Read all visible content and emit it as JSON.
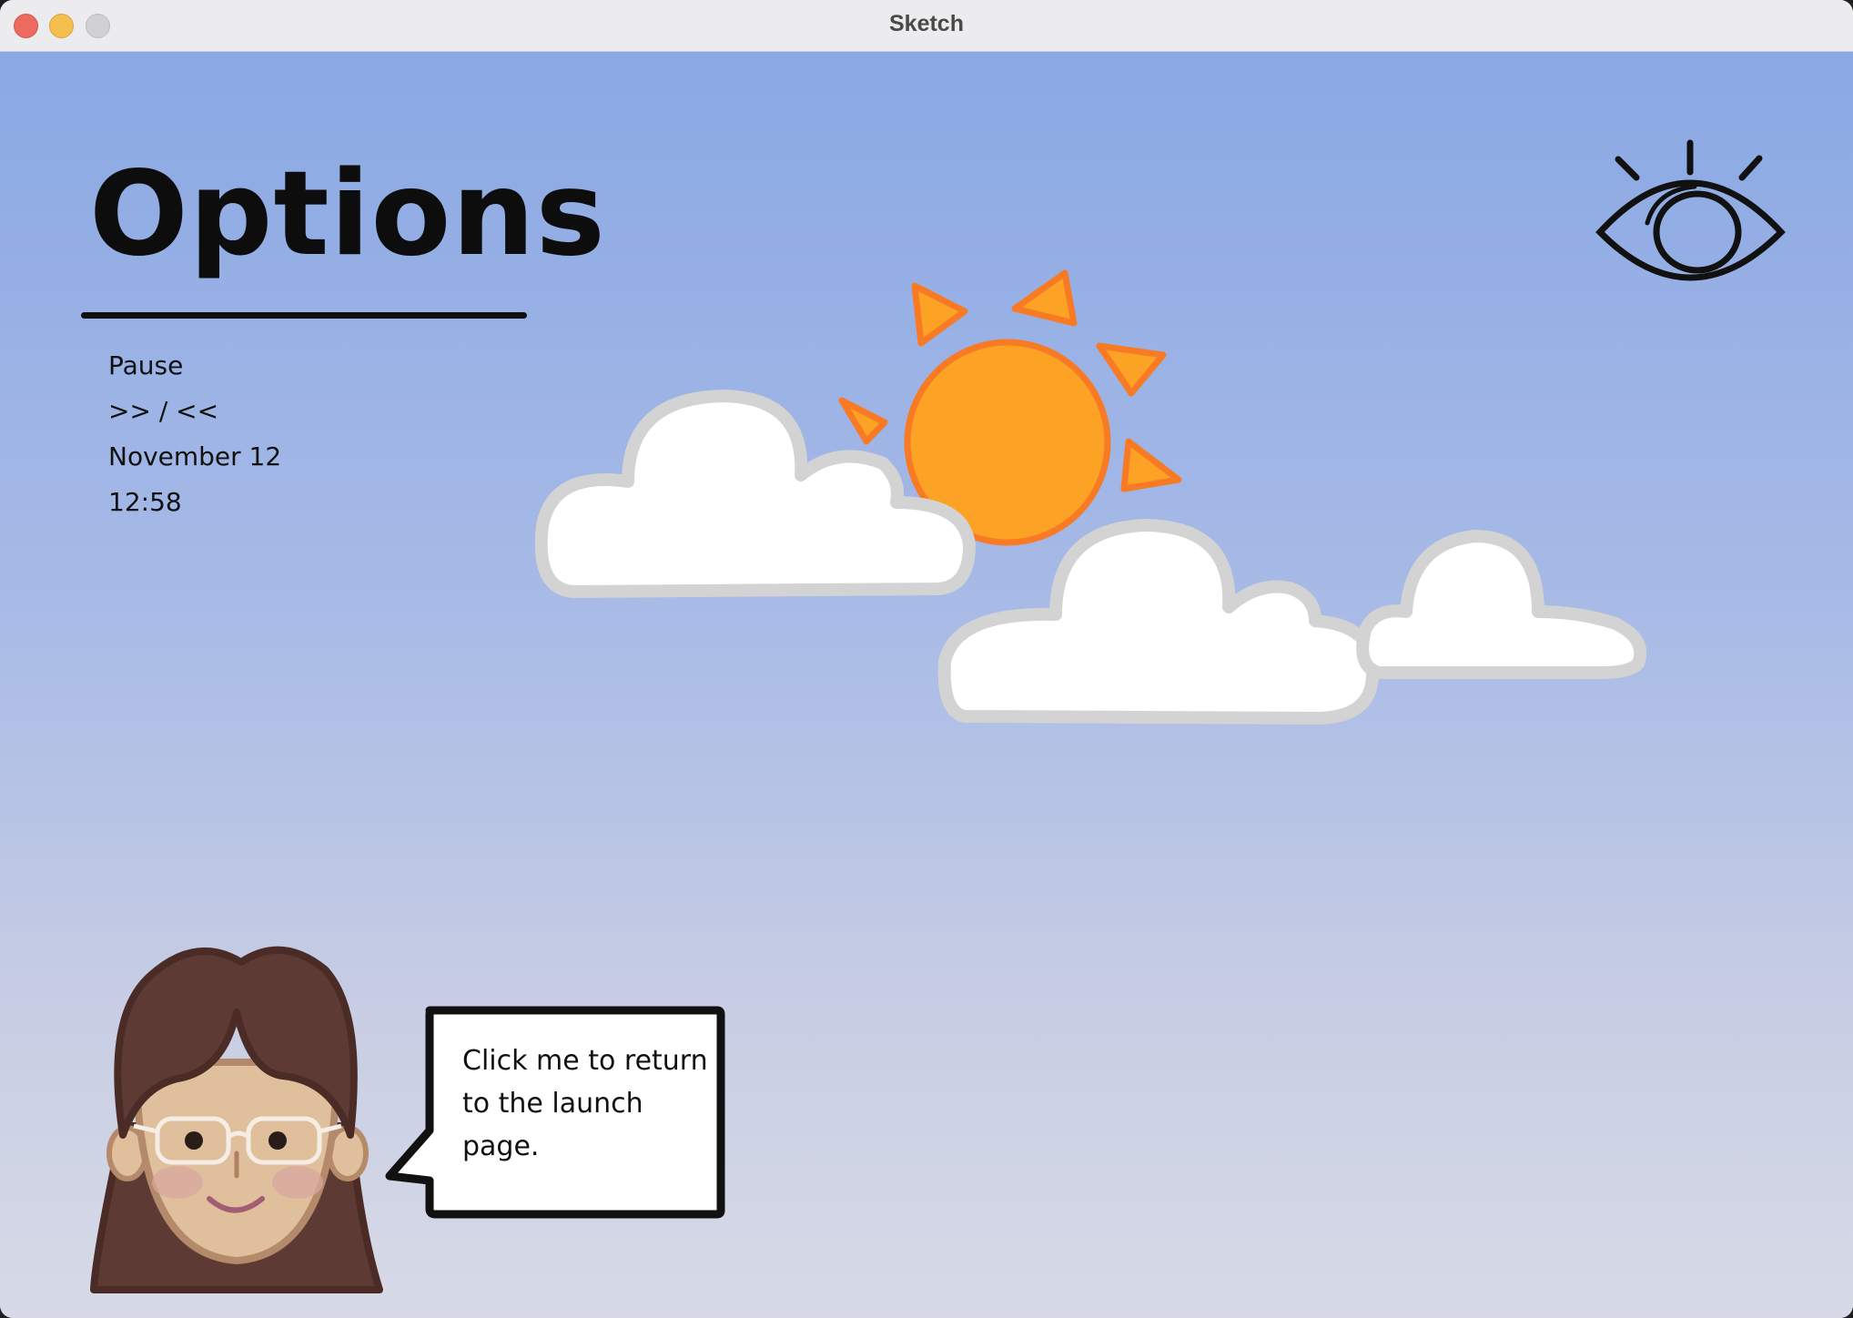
{
  "window": {
    "title": "Sketch"
  },
  "page": {
    "title": "Options",
    "menu": [
      {
        "label": "Pause"
      },
      {
        "label": ">> / <<"
      },
      {
        "label": "November 12"
      },
      {
        "label": "12:58"
      }
    ]
  },
  "icons": {
    "visibility": "eye-icon",
    "weather": "sun-with-clouds",
    "character": "avatar-woman-glasses"
  },
  "speech_bubble": {
    "text": "Click me to return to the launch page."
  },
  "colors": {
    "sky_top": "#89a8e4",
    "sky_bottom": "#d7dae6",
    "sun": "#fca224",
    "sun_outline": "#f97a24",
    "cloud": "#ffffff",
    "cloud_outline": "#d3d3d3",
    "hair": "#5d3a33",
    "skin": "#e0c09c"
  }
}
